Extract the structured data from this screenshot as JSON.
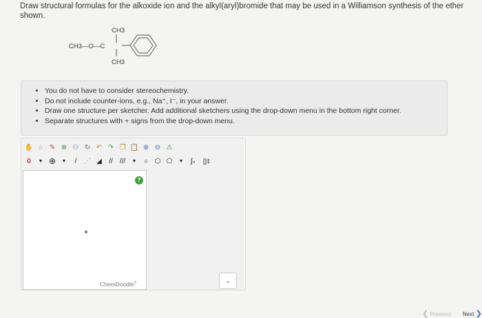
{
  "question": {
    "text": "Draw structural formulas for the alkoxide ion and the alkyl(aryl)bromide that may be used in a Williamson synthesis of the ether shown."
  },
  "molecule": {
    "left_group": "CH3—O—C",
    "top_group": "CH3",
    "bottom_group": "CH3"
  },
  "instructions": [
    "You do not have to consider stereochemistry.",
    "Do not include counter-ions, e.g., Na⁺, I⁻, in your answer.",
    "Draw one structure per sketcher. Add additional sketchers using the drop-down menu in the bottom right corner.",
    "Separate structures with + signs from the drop-down menu."
  ],
  "sketcher": {
    "toolbar1_icons": [
      "hand-icon",
      "eraser-icon",
      "pencil-icon",
      "ring-template-icon",
      "lasso-icon",
      "rotate-icon",
      "undo-icon",
      "redo-icon",
      "copy-icon",
      "paste-icon",
      "zoom-in-icon",
      "zoom-out-icon",
      "clear-icon"
    ],
    "toolbar2": {
      "charge_label": "0",
      "plus_label": "⊕",
      "brackets_label": "[]‡"
    },
    "help_label": "?",
    "brand": "ChemDoodle"
  },
  "footer": {
    "previous_label": "Previous",
    "next_label": "Next",
    "dropdown_glyph": "⌄"
  },
  "colors": {
    "accent": "#3a6fd0",
    "help_green": "#3aa33a"
  }
}
